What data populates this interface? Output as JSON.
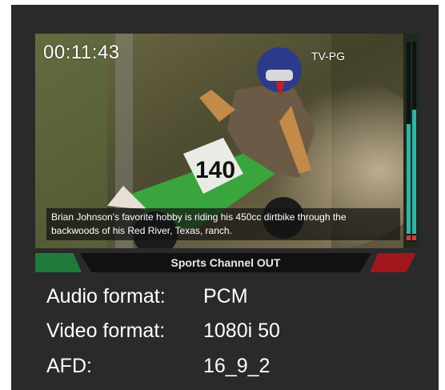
{
  "viewer": {
    "timecode": "00:11:43",
    "rating": "TV-PG",
    "caption": "Brian Johnson's favorite hobby is riding his 450cc dirtbike through the backwoods of his Red River, Texas, ranch.",
    "meters": {
      "left_level": 0.55,
      "right_level": 0.62
    }
  },
  "tally": {
    "label": "Sports Channel OUT",
    "left_color": "#1f7a3a",
    "right_color": "#a0181c"
  },
  "info": [
    {
      "key": "Audio format:",
      "value": "PCM"
    },
    {
      "key": "Video format:",
      "value": "1080i 50"
    },
    {
      "key": "AFD:",
      "value": "16_9_2"
    }
  ]
}
